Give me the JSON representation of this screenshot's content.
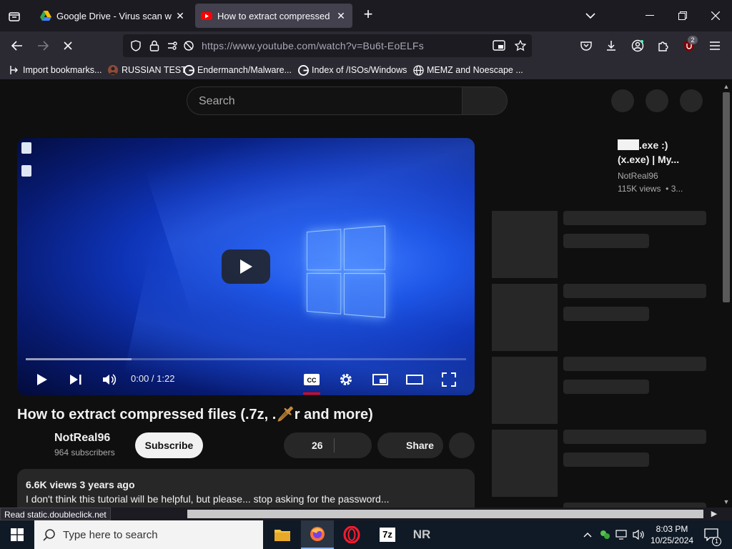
{
  "browser": {
    "tabs": [
      {
        "title": "Google Drive - Virus scan warning",
        "active": false,
        "icon": "google-drive-icon"
      },
      {
        "title": "How to extract compressed files",
        "active": true,
        "icon": "youtube-icon"
      }
    ],
    "url": "https://www.youtube.com/watch?v=Bu6t-EoELFs",
    "extension_badge": "2",
    "bookmarks": [
      {
        "label": "Import bookmarks...",
        "icon": "import-icon"
      },
      {
        "label": "RUSSIAN TEST",
        "icon": "user-icon"
      },
      {
        "label": "Endermanch/Malware...",
        "icon": "google-g-icon"
      },
      {
        "label": "Index of /ISOs/Windows",
        "icon": "google-g-icon"
      },
      {
        "label": "MEMZ and Noescape ...",
        "icon": "globe-icon"
      }
    ],
    "status_text": "Read static.doubleclick.net"
  },
  "youtube": {
    "search_placeholder": "Search",
    "player": {
      "time": "0:00 / 1:22",
      "loaded_fraction": 0.24
    },
    "video": {
      "title_part1": "How to extract compressed files (.7z, .",
      "title_part2": "r and more)",
      "channel": "NotReal96",
      "subscribers": "964 subscribers",
      "subscribe_label": "Subscribe",
      "likes": "26",
      "share_label": "Share",
      "views_date": "6.6K views  3 years ago",
      "description": "I don't think this tutorial will be helpful, but please... stop asking for the password..."
    },
    "recommended": {
      "title_part1": ".exe :)",
      "title_part2": "(x.exe) | My...",
      "channel": "NotReal96",
      "views": "115K views",
      "age": "3..."
    }
  },
  "taskbar": {
    "search_placeholder": "Type here to search",
    "time": "8:03 PM",
    "date": "10/25/2024",
    "notification_count": "1",
    "apps": [
      "file-explorer-icon",
      "firefox-icon",
      "opera-icon",
      "7zip-icon",
      "nr-icon"
    ],
    "nr_label": "NR",
    "sevenzip_label": "7z"
  }
}
